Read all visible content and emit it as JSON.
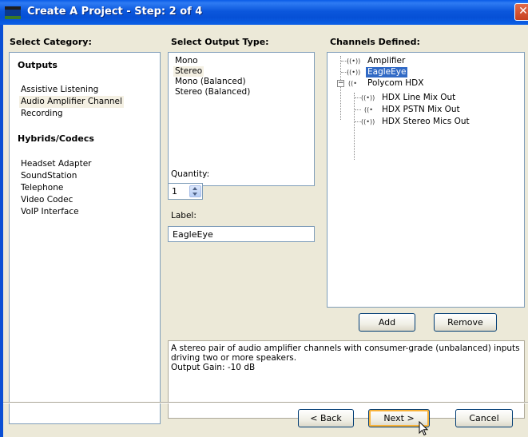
{
  "window": {
    "title": "Create A Project - Step: 2 of 4",
    "close_glyph": "✕"
  },
  "columns": {
    "category_header": "Select Category:",
    "output_type_header": "Select Output Type:",
    "channels_header": "Channels Defined:"
  },
  "categories": {
    "groups": [
      {
        "name": "Outputs",
        "items": [
          "Assistive Listening",
          "Audio Amplifier Channel",
          "Recording"
        ]
      },
      {
        "name": "Hybrids/Codecs",
        "items": [
          "Headset Adapter",
          "SoundStation",
          "Telephone",
          "Video Codec",
          "VoIP Interface"
        ]
      }
    ],
    "selected": "Audio Amplifier Channel"
  },
  "output_types": {
    "items": [
      "Mono",
      "Stereo",
      "Mono (Balanced)",
      "Stereo (Balanced)"
    ],
    "selected": "Stereo"
  },
  "quantity": {
    "label": "Quantity:",
    "value": "1"
  },
  "label_field": {
    "label": "Label:",
    "value": "EagleEye"
  },
  "channels": {
    "nodes": [
      {
        "icon": "((•))",
        "icon_name": "stereo-channel-icon",
        "text": "Amplifier"
      },
      {
        "icon": "((•))",
        "icon_name": "stereo-channel-icon",
        "text": "EagleEye",
        "selected": true
      },
      {
        "icon": "((•",
        "icon_name": "codec-device-icon",
        "text": "Polycom HDX",
        "expander": "−"
      },
      {
        "icon": "((•))",
        "icon_name": "stereo-channel-icon",
        "text": "HDX Line Mix Out"
      },
      {
        "icon": "((•",
        "icon_name": "mono-channel-icon",
        "text": "HDX PSTN Mix Out"
      },
      {
        "icon": "((•))",
        "icon_name": "stereo-channel-icon",
        "text": "HDX Stereo Mics Out"
      }
    ]
  },
  "buttons": {
    "add": "Add",
    "remove": "Remove",
    "back": "< Back",
    "next": "Next >",
    "cancel": "Cancel"
  },
  "description": {
    "lines": [
      "A stereo pair of audio amplifier channels with consumer-grade (unbalanced) inputs",
      "driving two or more speakers.",
      "Output Gain: -10 dB"
    ]
  },
  "colors": {
    "titlebar": "#0a5ce8",
    "dialog_bg": "#ece9d8",
    "selection": "#316ac5"
  }
}
